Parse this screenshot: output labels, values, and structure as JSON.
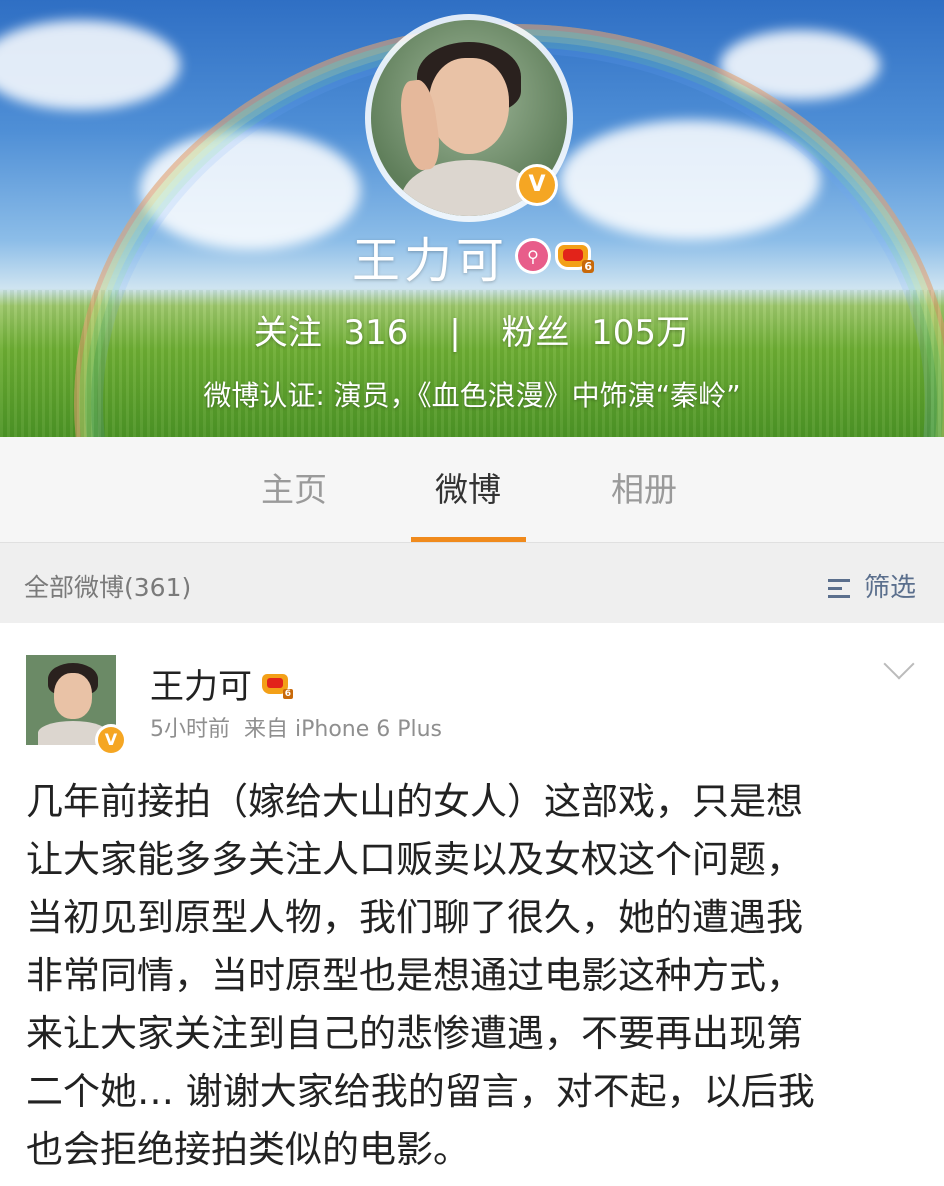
{
  "profile": {
    "name": "王力可",
    "stats": {
      "following_label": "关注",
      "following_value": "316",
      "separator": "|",
      "fans_label": "粉丝",
      "fans_value": "105万"
    },
    "verification": "微博认证: 演员，《血色浪漫》中饰演“秦岭”",
    "badge_letter": "V",
    "level_badge": "6"
  },
  "tabs": [
    {
      "label": "主页",
      "active": false
    },
    {
      "label": "微博",
      "active": true
    },
    {
      "label": "相册",
      "active": false
    }
  ],
  "filter_bar": {
    "count_label": "全部微博(361)",
    "filter_label": "筛选"
  },
  "post": {
    "author": "王力可",
    "time": "5小时前",
    "source": "来自 iPhone 6 Plus",
    "lines": [
      "几年前接拍（嫁给大山的女人）这部戏，只是想",
      "让大家能多多关注人口贩卖以及女权这个问题，",
      "当初见到原型人物，我们聊了很久，她的遭遇我",
      "非常同情，当时原型也是想通过电影这种方式，",
      "来让大家关注到自己的悲惨遭遇，不要再出现第",
      "二个她… 谢谢大家给我的留言，对不起，以后我",
      "也会拒绝接拍类似的电影。"
    ]
  },
  "colors": {
    "accent_orange": "#f08a1c",
    "verified_badge": "#f5a623",
    "filter_blue": "#5b6f8d"
  },
  "icons": [
    "verified-badge-icon",
    "search-badge-icon",
    "vip-crown-icon",
    "filter-icon",
    "chevron-down-icon"
  ]
}
